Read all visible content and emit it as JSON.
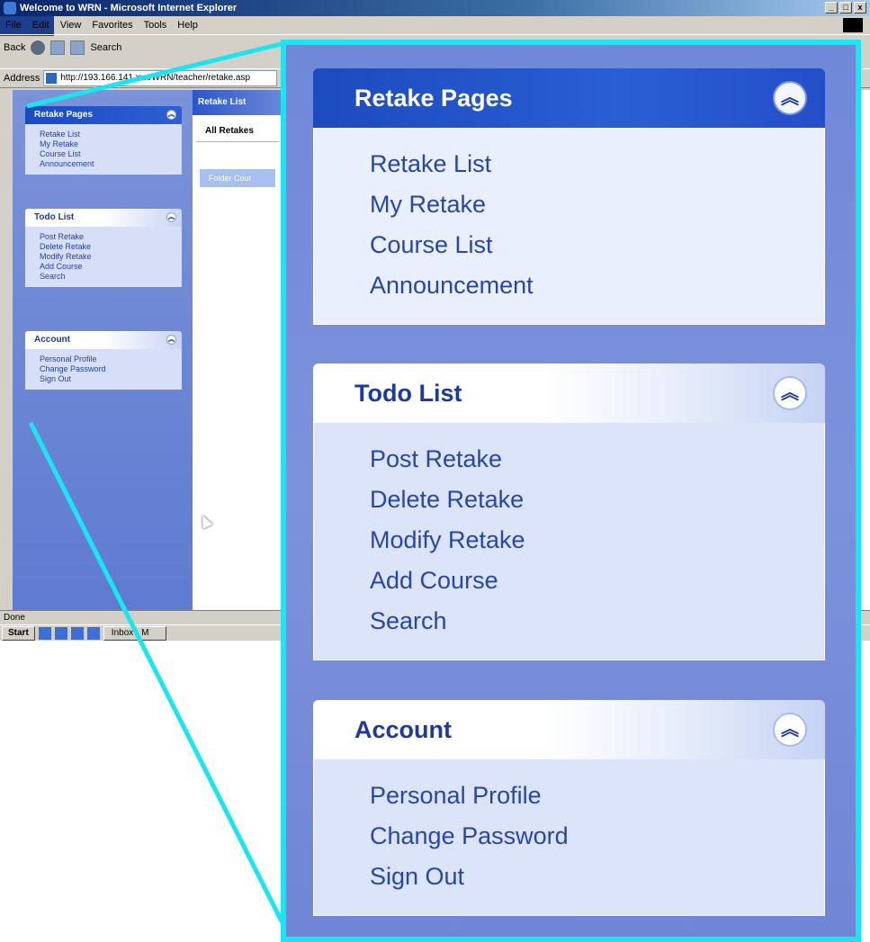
{
  "window": {
    "title": "Welcome to WRN - Microsoft Internet Explorer",
    "controls": [
      "_",
      "□",
      "x"
    ]
  },
  "menubar": [
    "File",
    "Edit",
    "View",
    "Favorites",
    "Tools",
    "Help"
  ],
  "toolbar": {
    "back_label": "Back",
    "search_label": "Search"
  },
  "address": {
    "label": "Address",
    "value": "http://193.166.141.xxx/WRN/teacher/retake.asp"
  },
  "status": {
    "text": "Done"
  },
  "taskbar": {
    "start_label": "Start",
    "task_label": "Inbox - M"
  },
  "background_page": {
    "right_title": "Retake List",
    "right_subtitle": "All Retakes",
    "table_header": "Folder   Cour"
  },
  "sidebar": {
    "panels": [
      {
        "title": "Retake Pages",
        "items": [
          "Retake List",
          "My Retake",
          "Course List",
          "Announcement"
        ]
      },
      {
        "title": "Todo List",
        "items": [
          "Post Retake",
          "Delete Retake",
          "Modify Retake",
          "Add Course",
          "Search"
        ]
      },
      {
        "title": "Account",
        "items": [
          "Personal Profile",
          "Change Password",
          "Sign Out"
        ]
      }
    ]
  },
  "icons": {
    "collapse": "chevron-double-up-icon",
    "collapse_glyph": "︽"
  },
  "colors": {
    "callout": "#19e6f0",
    "panel_header_dark": "#1c4bbf",
    "panel_header_text_light": "#1d3aa0",
    "link": "#2846a8",
    "sidebar_bg": "#6f88d8"
  }
}
